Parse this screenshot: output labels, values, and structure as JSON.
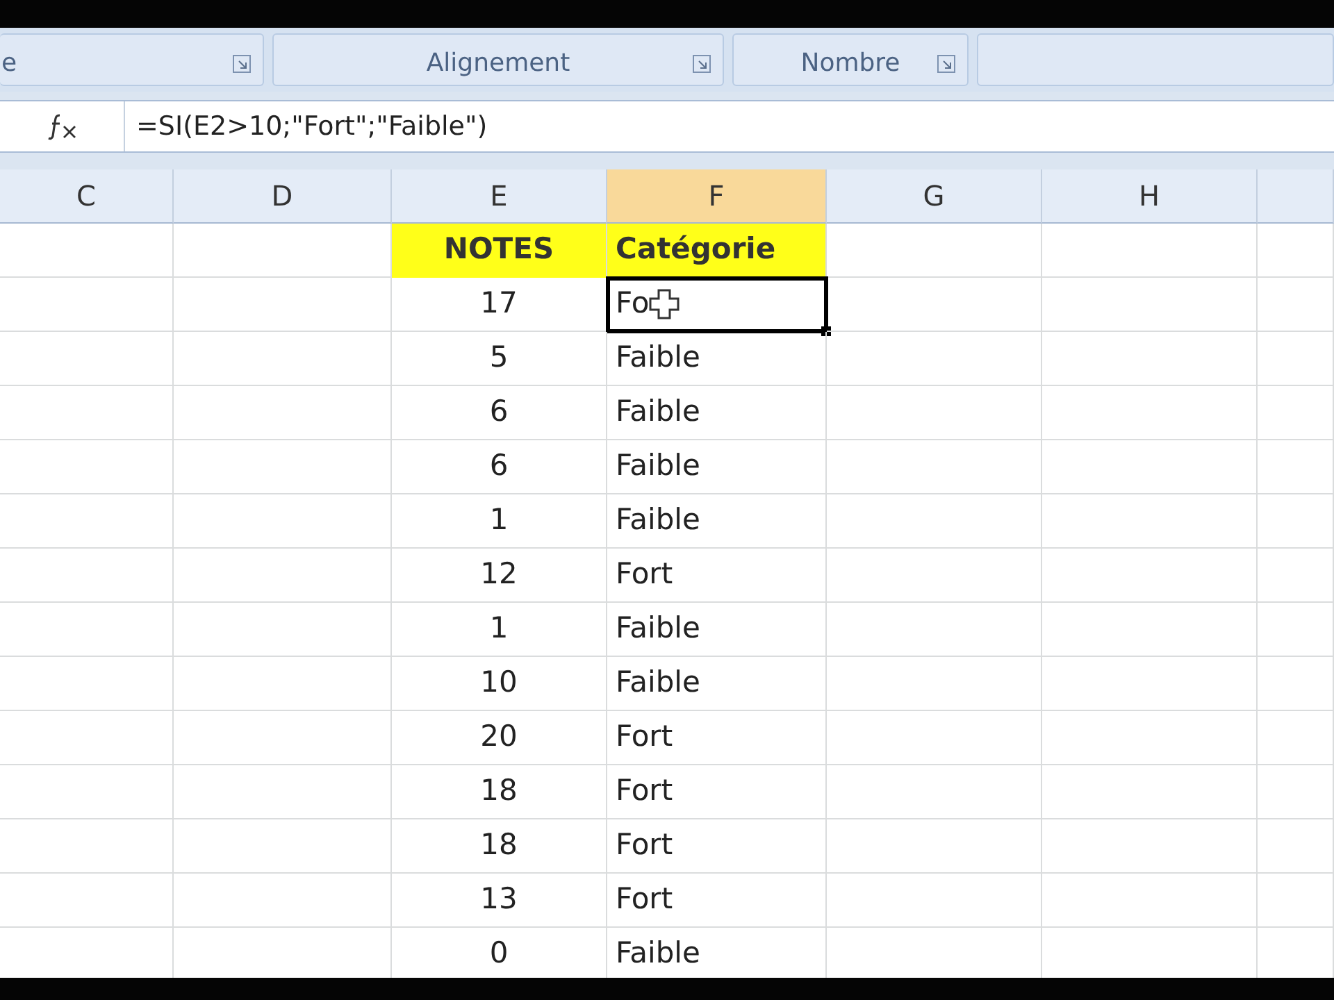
{
  "ribbon_groups": [
    {
      "label": "e"
    },
    {
      "label": "Alignement"
    },
    {
      "label": "Nombre"
    }
  ],
  "formula_bar": {
    "formula": "=SI(E2>10;\"Fort\";\"Faible\")"
  },
  "columns": [
    {
      "label": "C",
      "selected": false
    },
    {
      "label": "D",
      "selected": false
    },
    {
      "label": "E",
      "selected": false
    },
    {
      "label": "F",
      "selected": true
    },
    {
      "label": "G",
      "selected": false
    },
    {
      "label": "H",
      "selected": false
    }
  ],
  "header_row": {
    "notes": "NOTES",
    "category": "Catégorie"
  },
  "rows": [
    {
      "notes": "17",
      "category": "Fo",
      "selected": true
    },
    {
      "notes": "5",
      "category": "Faible",
      "selected": false
    },
    {
      "notes": "6",
      "category": "Faible",
      "selected": false
    },
    {
      "notes": "6",
      "category": "Faible",
      "selected": false
    },
    {
      "notes": "1",
      "category": "Faible",
      "selected": false
    },
    {
      "notes": "12",
      "category": "Fort",
      "selected": false
    },
    {
      "notes": "1",
      "category": "Faible",
      "selected": false
    },
    {
      "notes": "10",
      "category": "Faible",
      "selected": false
    },
    {
      "notes": "20",
      "category": "Fort",
      "selected": false
    },
    {
      "notes": "18",
      "category": "Fort",
      "selected": false
    },
    {
      "notes": "18",
      "category": "Fort",
      "selected": false
    },
    {
      "notes": "13",
      "category": "Fort",
      "selected": false
    },
    {
      "notes": "0",
      "category": "Faible",
      "selected": false
    }
  ]
}
